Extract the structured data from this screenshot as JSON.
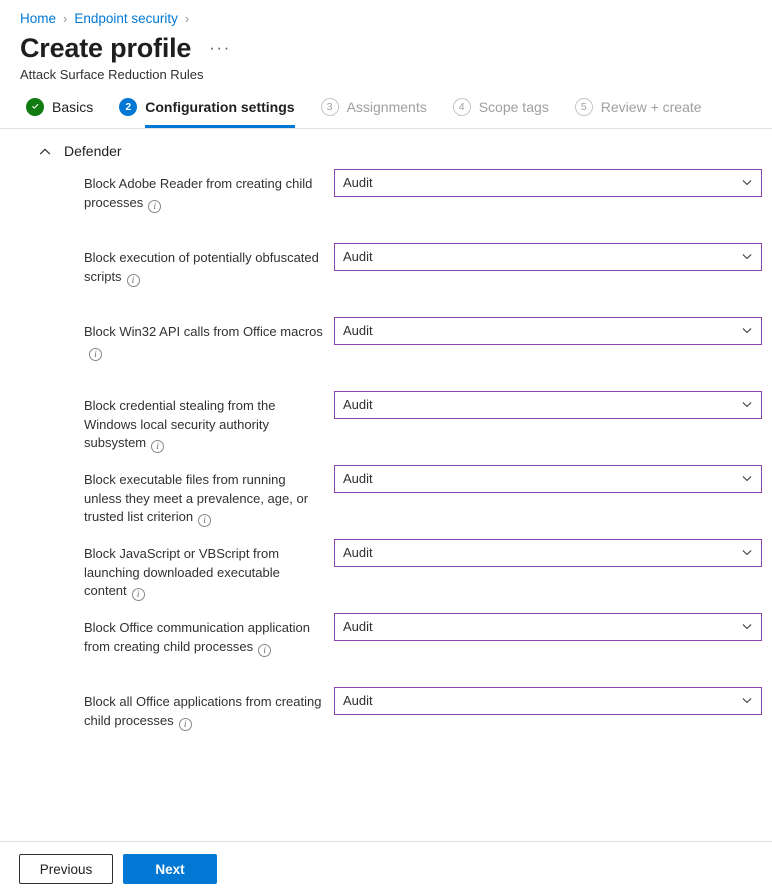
{
  "breadcrumb": {
    "items": [
      {
        "label": "Home"
      },
      {
        "label": "Endpoint security"
      }
    ],
    "separator": "›"
  },
  "header": {
    "title": "Create profile",
    "subtitle": "Attack Surface Reduction Rules",
    "ellipsis": "···"
  },
  "steps": [
    {
      "badge": "✓",
      "label": "Basics",
      "state": "done"
    },
    {
      "badge": "2",
      "label": "Configuration settings",
      "state": "current"
    },
    {
      "badge": "3",
      "label": "Assignments",
      "state": "pending"
    },
    {
      "badge": "4",
      "label": "Scope tags",
      "state": "pending"
    },
    {
      "badge": "5",
      "label": "Review + create",
      "state": "pending"
    }
  ],
  "section": {
    "title": "Defender",
    "expanded": true
  },
  "settings": [
    {
      "label": "Block Adobe Reader from creating child processes",
      "value": "Audit"
    },
    {
      "label": "Block execution of potentially obfuscated scripts",
      "value": "Audit"
    },
    {
      "label": "Block Win32 API calls from Office macros",
      "value": "Audit"
    },
    {
      "label": "Block credential stealing from the Windows local security authority subsystem",
      "value": "Audit"
    },
    {
      "label": "Block executable files from running unless they meet a prevalence, age, or trusted list criterion",
      "value": "Audit"
    },
    {
      "label": "Block JavaScript or VBScript from launching downloaded executable content",
      "value": "Audit"
    },
    {
      "label": "Block Office communication application from creating child processes",
      "value": "Audit"
    },
    {
      "label": "Block all Office applications from creating child processes",
      "value": "Audit"
    }
  ],
  "footer": {
    "previous_label": "Previous",
    "next_label": "Next"
  },
  "colors": {
    "accent": "#0078d4",
    "success": "#107c10",
    "combo_border": "#8e44ad",
    "link": "#0078d4",
    "disabled_text": "#a19f9d"
  }
}
